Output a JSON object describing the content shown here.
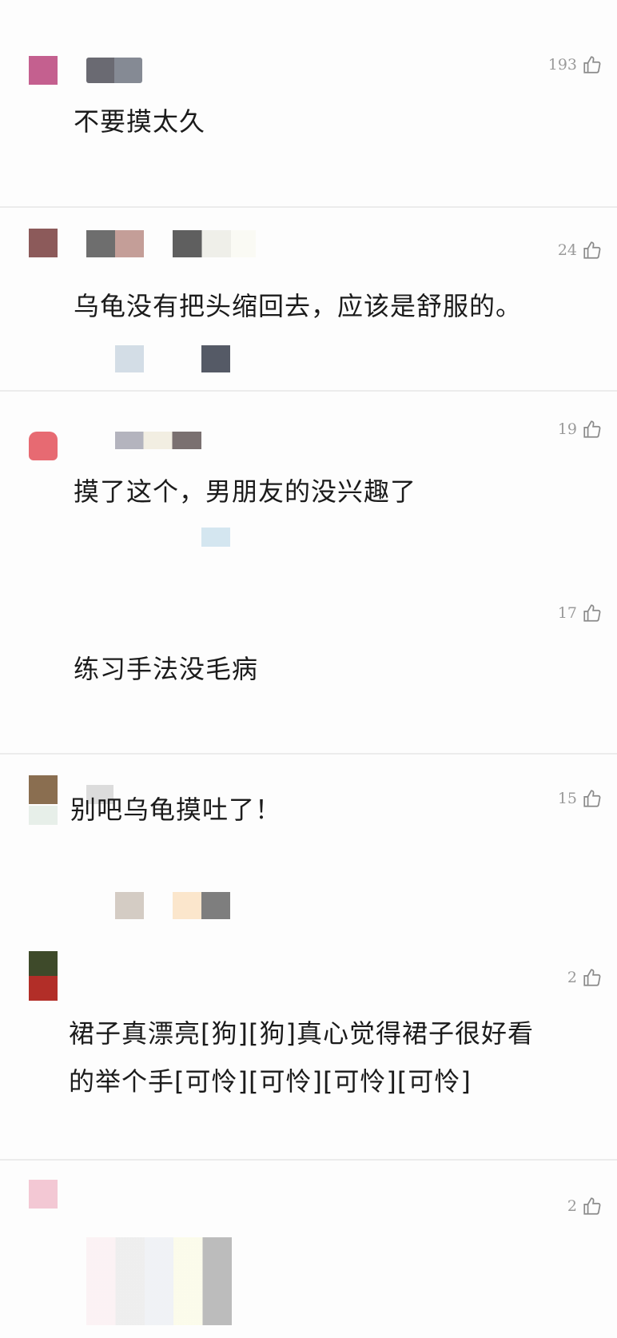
{
  "comments": [
    {
      "text": "不要摸太久",
      "likes": "193"
    },
    {
      "text": "乌龟没有把头缩回去，应该是舒服的。",
      "likes": "24"
    },
    {
      "text": "摸了这个，男朋友的没兴趣了",
      "likes": "19"
    },
    {
      "text": "练习手法没毛病",
      "likes": "17"
    },
    {
      "text": "别吧乌龟摸吐了！",
      "likes": "15"
    },
    {
      "text": "裙子真漂亮[狗][狗]真心觉得裙子很好看",
      "text2": "的举个手[可怜][可怜][可怜][可怜]",
      "likes": "2"
    },
    {
      "text": "",
      "likes": "2"
    }
  ],
  "icons": {
    "like": "thumbs-up-icon"
  },
  "colors": {
    "divider": "#ececec",
    "likes": "#9a9a9a"
  }
}
